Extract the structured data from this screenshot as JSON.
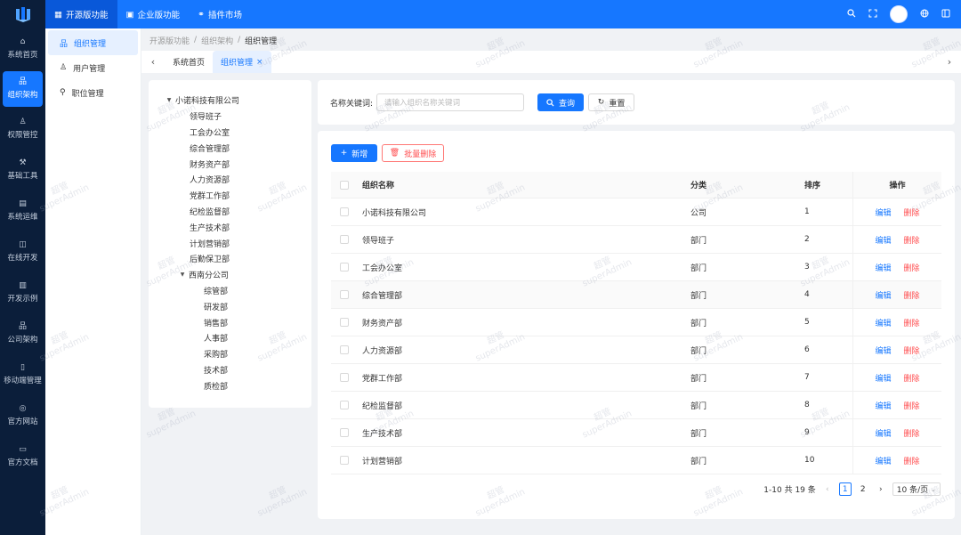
{
  "top_nav": [
    {
      "label": "开源版功能",
      "icon": "grid-icon",
      "active": true
    },
    {
      "label": "企业版功能",
      "icon": "square-icon",
      "active": false
    },
    {
      "label": "插件市场",
      "icon": "link-icon",
      "active": false
    }
  ],
  "left_nav": [
    {
      "label": "系统首页",
      "icon": "home-icon",
      "active": false
    },
    {
      "label": "组织架构",
      "icon": "org-icon",
      "active": true
    },
    {
      "label": "权限管控",
      "icon": "user-icon",
      "active": false
    },
    {
      "label": "基础工具",
      "icon": "wrench-icon",
      "active": false
    },
    {
      "label": "系统运维",
      "icon": "server-icon",
      "active": false
    },
    {
      "label": "在线开发",
      "icon": "code-icon",
      "active": false
    },
    {
      "label": "开发示例",
      "icon": "doc-icon",
      "active": false
    },
    {
      "label": "公司架构",
      "icon": "building-icon",
      "active": false
    },
    {
      "label": "移动端管理",
      "icon": "phone-icon",
      "active": false
    },
    {
      "label": "官方网站",
      "icon": "globe-icon",
      "active": false
    },
    {
      "label": "官方文档",
      "icon": "book-icon",
      "active": false
    }
  ],
  "submenu": [
    {
      "label": "组织管理",
      "icon": "org-icon",
      "active": true
    },
    {
      "label": "用户管理",
      "icon": "user-icon",
      "active": false
    },
    {
      "label": "职位管理",
      "icon": "position-icon",
      "active": false
    }
  ],
  "breadcrumb": [
    "开源版功能",
    "组织架构",
    "组织管理"
  ],
  "tabs": [
    {
      "label": "系统首页",
      "active": false
    },
    {
      "label": "组织管理",
      "active": true
    }
  ],
  "tree": [
    {
      "label": "小诺科技有限公司",
      "level": 0,
      "expanded": true
    },
    {
      "label": "领导班子",
      "level": 1
    },
    {
      "label": "工会办公室",
      "level": 1
    },
    {
      "label": "综合管理部",
      "level": 1
    },
    {
      "label": "财务资产部",
      "level": 1
    },
    {
      "label": "人力资源部",
      "level": 1
    },
    {
      "label": "党群工作部",
      "level": 1
    },
    {
      "label": "纪检监督部",
      "level": 1
    },
    {
      "label": "生产技术部",
      "level": 1
    },
    {
      "label": "计划营销部",
      "level": 1
    },
    {
      "label": "后勤保卫部",
      "level": 1
    },
    {
      "label": "西南分公司",
      "level": 1,
      "expanded": true
    },
    {
      "label": "综管部",
      "level": 2
    },
    {
      "label": "研发部",
      "level": 2
    },
    {
      "label": "销售部",
      "level": 2
    },
    {
      "label": "人事部",
      "level": 2
    },
    {
      "label": "采购部",
      "level": 2
    },
    {
      "label": "技术部",
      "level": 2
    },
    {
      "label": "质检部",
      "level": 2
    }
  ],
  "search": {
    "label": "名称关键词:",
    "placeholder": "请输入组织名称关键词",
    "query_label": "查询",
    "reset_label": "重置"
  },
  "actions": {
    "add_label": "新增",
    "batch_delete_label": "批量删除"
  },
  "table": {
    "columns": [
      "组织名称",
      "分类",
      "排序",
      "操作"
    ],
    "edit_label": "编辑",
    "delete_label": "删除",
    "rows": [
      {
        "name": "小诺科技有限公司",
        "type": "公司",
        "sort": "1"
      },
      {
        "name": "领导班子",
        "type": "部门",
        "sort": "2"
      },
      {
        "name": "工会办公室",
        "type": "部门",
        "sort": "3"
      },
      {
        "name": "综合管理部",
        "type": "部门",
        "sort": "4"
      },
      {
        "name": "财务资产部",
        "type": "部门",
        "sort": "5"
      },
      {
        "name": "人力资源部",
        "type": "部门",
        "sort": "6"
      },
      {
        "name": "党群工作部",
        "type": "部门",
        "sort": "7"
      },
      {
        "name": "纪检监督部",
        "type": "部门",
        "sort": "8"
      },
      {
        "name": "生产技术部",
        "type": "部门",
        "sort": "9"
      },
      {
        "name": "计划营销部",
        "type": "部门",
        "sort": "10"
      }
    ]
  },
  "pagination": {
    "summary": "1-10 共 19 条",
    "pages": [
      "1",
      "2"
    ],
    "current_page": "1",
    "page_size": "10 条/页"
  },
  "watermark": {
    "line1": "超管",
    "line2": "superAdmin"
  },
  "colors": {
    "primary": "#1677ff",
    "sidebar": "#0b1e3a",
    "danger": "#ff4d4f"
  }
}
